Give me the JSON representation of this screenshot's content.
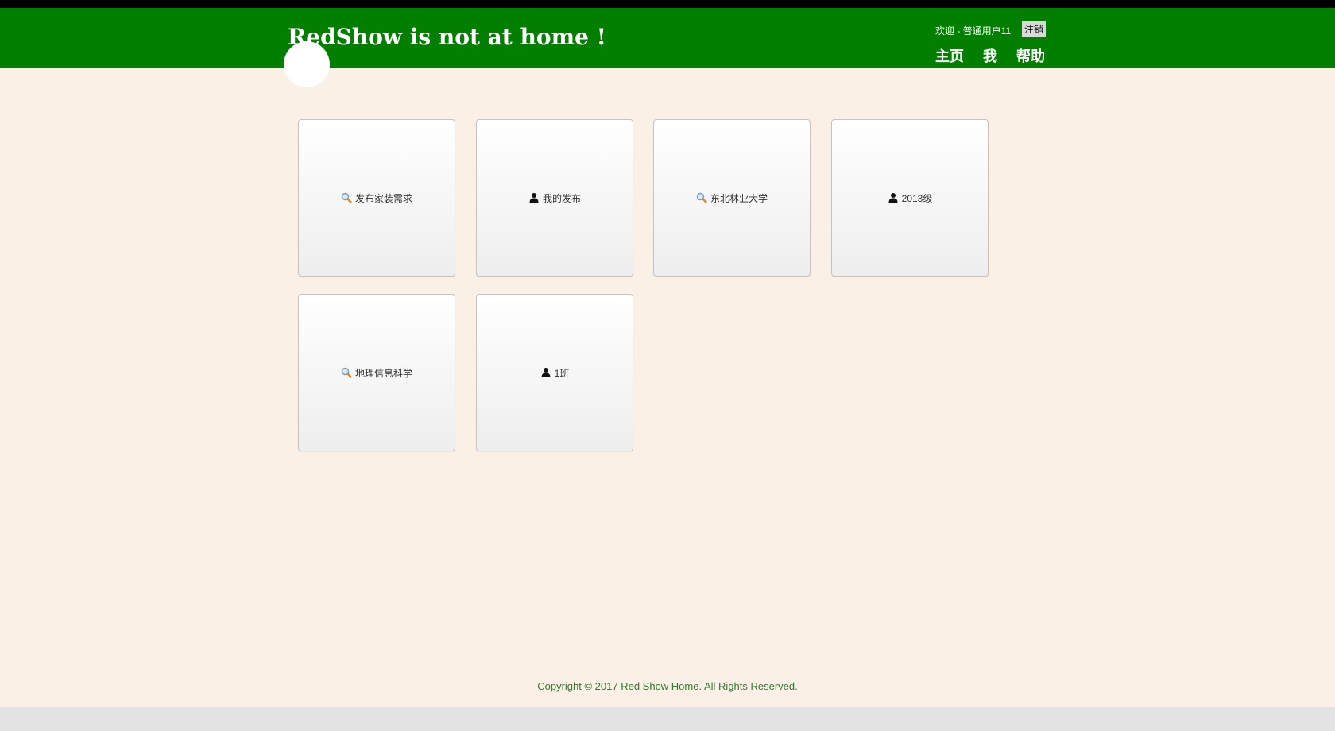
{
  "header": {
    "title": "RedShow is not at home !",
    "welcome": "欢迎 - 普通用户11",
    "logout_label": "注销",
    "nav": [
      "主页",
      "我",
      "帮助"
    ],
    "brand_color": "#027e01"
  },
  "tiles": [
    {
      "icon": "search-icon",
      "label": "发布家装需求"
    },
    {
      "icon": "user-icon",
      "label": "我的发布"
    },
    {
      "icon": "search-icon",
      "label": "东北林业大学"
    },
    {
      "icon": "user-icon",
      "label": "2013级"
    },
    {
      "icon": "search-icon",
      "label": "地理信息科学"
    },
    {
      "icon": "user-icon",
      "label": "1班"
    }
  ],
  "footer": {
    "copyright": "Copyright © 2017 Red Show Home. All Rights Reserved."
  }
}
